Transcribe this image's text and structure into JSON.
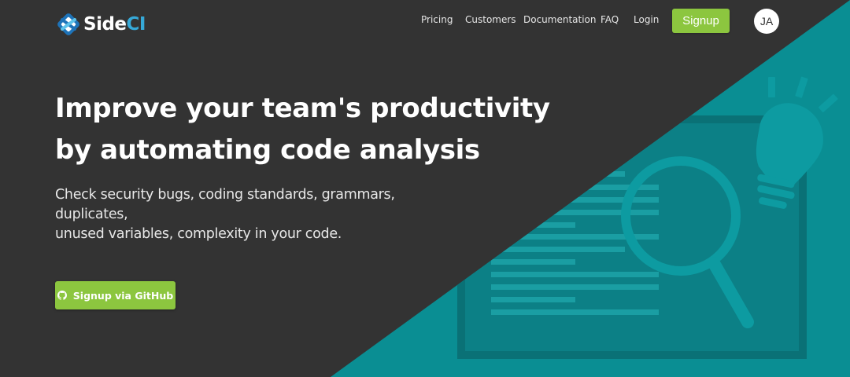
{
  "colors": {
    "background": "#333333",
    "accent_teal": "#0a8e93",
    "illustration_dark": "#0a7478",
    "illustration_line": "#1a9ea3",
    "primary_green": "#8cc63f",
    "logo_ci_blue": "#36a9d8"
  },
  "nav": {
    "logo": {
      "name": "Side",
      "suffix": "CI",
      "icon": "sideci-logo-icon"
    },
    "links": [
      {
        "label": "Pricing"
      },
      {
        "label": "Customers"
      },
      {
        "label": "Documentation"
      },
      {
        "label": "FAQ"
      },
      {
        "label": "Login"
      }
    ],
    "signup_label": "Signup",
    "avatar_initials": "JA"
  },
  "hero": {
    "title_line1": "Improve your team's productivity",
    "title_line2": "by automating code analysis",
    "subtitle_line1": "Check security bugs, coding standards, grammars, duplicates,",
    "subtitle_line2": "unused variables, complexity in your code.",
    "cta_label": "Signup via GitHub",
    "cta_icon": "github-icon"
  }
}
